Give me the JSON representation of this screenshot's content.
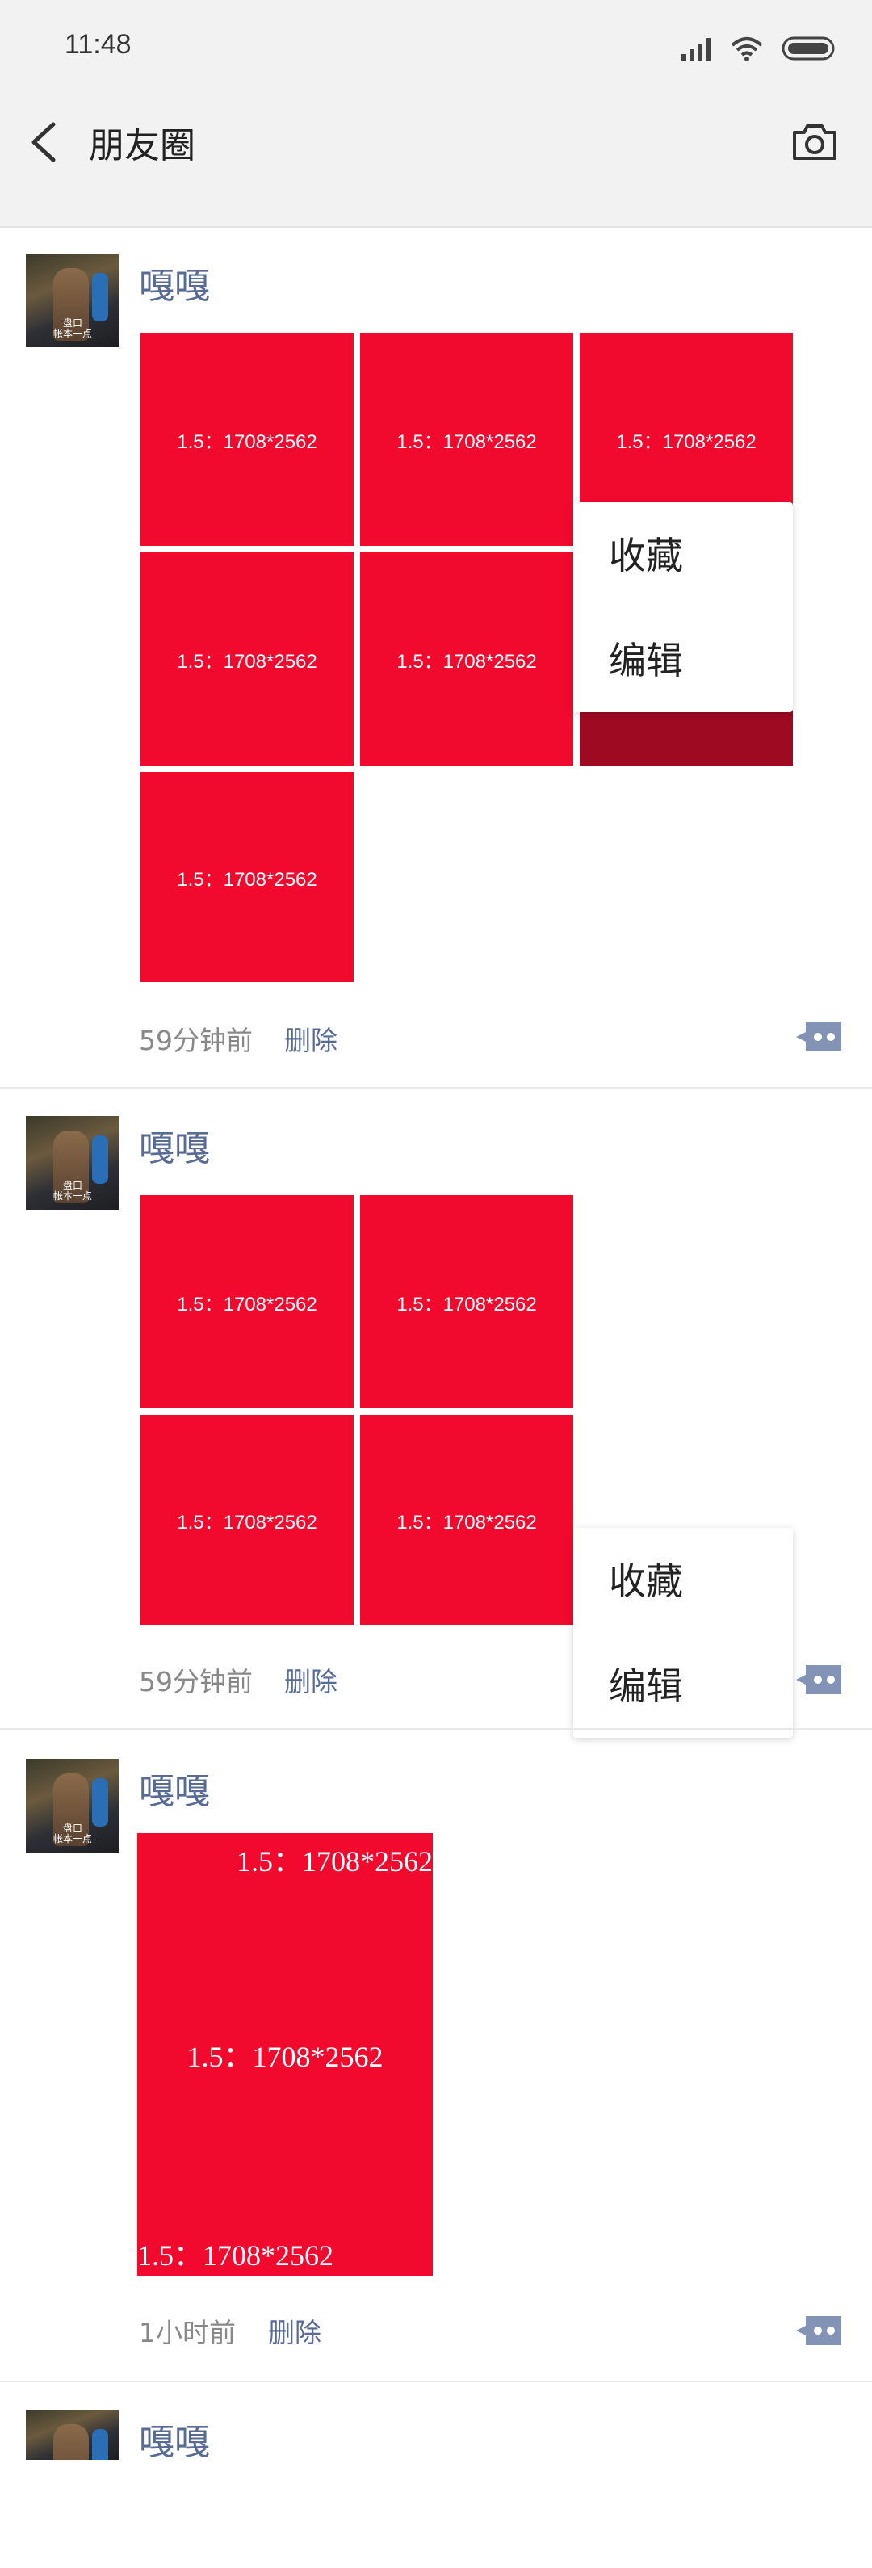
{
  "status": {
    "time": "11:48"
  },
  "header": {
    "title": "朋友圈"
  },
  "image_label": "1.5：1708*2562",
  "avatar_caption": "盘口\n帐本一点",
  "menu": {
    "collect": "收藏",
    "edit": "编辑"
  },
  "posts": [
    {
      "username": "嘎嘎",
      "time": "59分钟前",
      "delete": "删除"
    },
    {
      "username": "嘎嘎",
      "time": "59分钟前",
      "delete": "删除"
    },
    {
      "username": "嘎嘎",
      "time": "1小时前",
      "delete": "删除"
    },
    {
      "username": "嘎嘎"
    }
  ],
  "colors": {
    "image_red": "#f20a2e",
    "link_blue": "#576b95",
    "header_bg": "#f2f2f2"
  }
}
